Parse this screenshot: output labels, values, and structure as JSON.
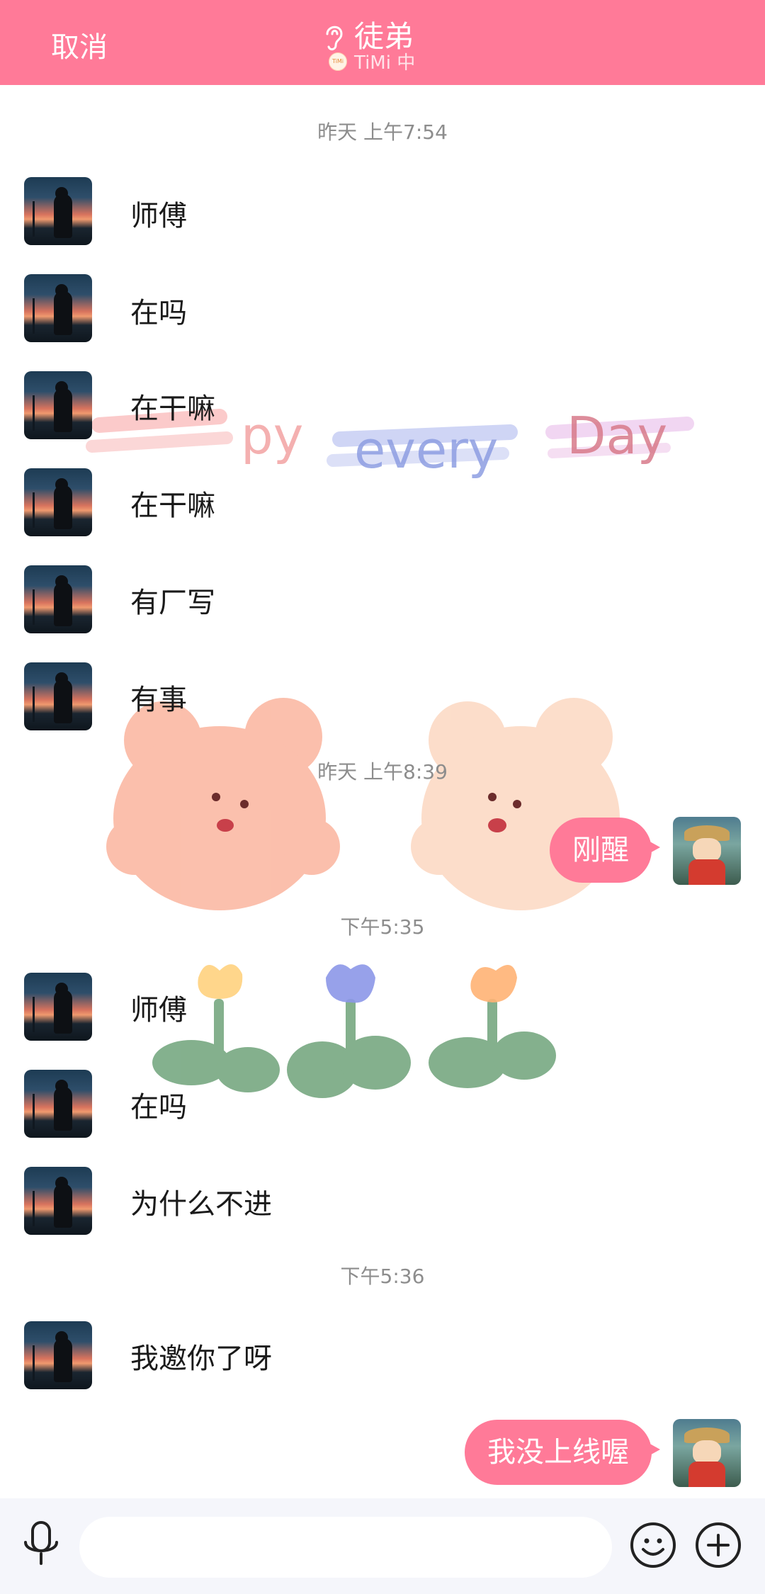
{
  "header": {
    "cancel_label": "取消",
    "title": "徒弟",
    "subtitle": "TiMi 中",
    "badge_label": "TiMi"
  },
  "chat": {
    "timestamps": [
      "昨天 上午7:54",
      "昨天 上午8:39",
      "下午5:35",
      "下午5:36"
    ],
    "messages": [
      {
        "side": "left",
        "text": "师傅"
      },
      {
        "side": "left",
        "text": "在吗"
      },
      {
        "side": "left",
        "text": "在干嘛"
      },
      {
        "side": "left",
        "text": "在干嘛"
      },
      {
        "side": "left",
        "text": "有厂写"
      },
      {
        "side": "left",
        "text": "有事"
      },
      {
        "side": "right",
        "text": "刚醒"
      },
      {
        "side": "left",
        "text": "师傅"
      },
      {
        "side": "left",
        "text": "在吗"
      },
      {
        "side": "left",
        "text": "为什么不进"
      },
      {
        "side": "left",
        "text": "我邀你了呀"
      },
      {
        "side": "right",
        "text": "我没上线喔"
      }
    ],
    "sticker_text": "Happy every Day"
  },
  "input": {
    "placeholder": ""
  },
  "colors": {
    "accent": "#ff7a98",
    "background": "#ffffff",
    "inputbar": "#f5f6fb"
  },
  "icons": [
    "ear-icon",
    "mic-icon",
    "emoji-icon",
    "plus-icon"
  ]
}
